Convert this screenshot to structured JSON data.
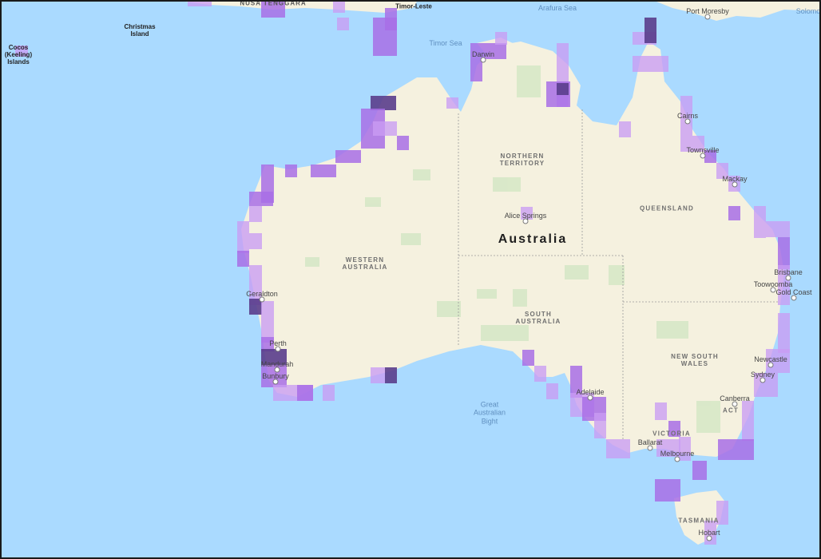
{
  "map": {
    "country_label": "Australia",
    "states": [
      {
        "id": "nt",
        "lines": [
          "NORTHERN",
          "TERRITORY"
        ]
      },
      {
        "id": "qld",
        "lines": [
          "QUEENSLAND"
        ]
      },
      {
        "id": "wa",
        "lines": [
          "WESTERN",
          "AUSTRALIA"
        ]
      },
      {
        "id": "sa",
        "lines": [
          "SOUTH",
          "AUSTRALIA"
        ]
      },
      {
        "id": "nsw",
        "lines": [
          "NEW SOUTH",
          "WALES"
        ]
      },
      {
        "id": "vic",
        "lines": [
          "VICTORIA"
        ]
      },
      {
        "id": "act",
        "lines": [
          "ACT"
        ]
      },
      {
        "id": "tas",
        "lines": [
          "TASMANIA"
        ]
      }
    ],
    "seas": [
      {
        "id": "arafura",
        "lines": [
          "Arafura Sea"
        ]
      },
      {
        "id": "timor",
        "lines": [
          "Timor Sea"
        ]
      },
      {
        "id": "bight",
        "lines": [
          "Great",
          "Australian",
          "Bight"
        ]
      },
      {
        "id": "solomon",
        "lines": [
          "Solomo"
        ]
      }
    ],
    "islands": [
      {
        "id": "christmas",
        "lines": [
          "Christmas",
          "Island"
        ]
      },
      {
        "id": "cocos",
        "lines": [
          "Cocos",
          "(Keeling)",
          "Islands"
        ]
      },
      {
        "id": "timor-leste",
        "lines": [
          "Timor-Leste"
        ]
      },
      {
        "id": "nusa-tenggara",
        "lines": [
          "NUSA TENGGARA"
        ]
      }
    ],
    "cities": [
      {
        "id": "darwin",
        "name": "Darwin"
      },
      {
        "id": "cairns",
        "name": "Cairns"
      },
      {
        "id": "townsville",
        "name": "Townsville"
      },
      {
        "id": "mackay",
        "name": "Mackay"
      },
      {
        "id": "alice-springs",
        "name": "Alice Springs"
      },
      {
        "id": "brisbane",
        "name": "Brisbane"
      },
      {
        "id": "toowoomba",
        "name": "Toowoomba"
      },
      {
        "id": "gold-coast",
        "name": "Gold Coast"
      },
      {
        "id": "geraldton",
        "name": "Geraldton"
      },
      {
        "id": "perth",
        "name": "Perth"
      },
      {
        "id": "mandurah",
        "name": "Mandurah"
      },
      {
        "id": "bunbury",
        "name": "Bunbury"
      },
      {
        "id": "adelaide",
        "name": "Adelaide"
      },
      {
        "id": "newcastle",
        "name": "Newcastle"
      },
      {
        "id": "sydney",
        "name": "Sydney"
      },
      {
        "id": "canberra",
        "name": "Canberra"
      },
      {
        "id": "ballarat",
        "name": "Ballarat"
      },
      {
        "id": "melbourne",
        "name": "Melbourne"
      },
      {
        "id": "hobart",
        "name": "Hobart"
      },
      {
        "id": "port-moresby",
        "name": "Port Moresby"
      }
    ],
    "colors": {
      "ocean": "#aadaff",
      "land": "#f5f1df",
      "desert": "#faf1cc",
      "park": "#d7e8c7",
      "overlay_light": "#c99cf3",
      "overlay_mid": "#a86ee6",
      "overlay_dark": "#5a3d8c"
    }
  }
}
